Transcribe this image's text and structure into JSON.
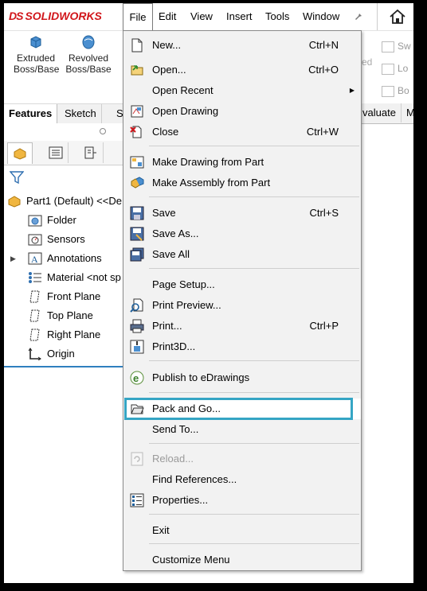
{
  "app": {
    "logo_prefix": "DS",
    "logo_text": "SOLIDWORKS"
  },
  "menubar": {
    "items": [
      "File",
      "Edit",
      "View",
      "Insert",
      "Tools",
      "Window"
    ],
    "pin_icon": "pin-icon",
    "home_icon": "home-icon"
  },
  "command_manager": {
    "extruded": {
      "line1": "Extruded",
      "line2": "Boss/Base",
      "icon": "extruded-boss-icon"
    },
    "revolved": {
      "line1": "Revolved",
      "line2": "Boss/Base",
      "icon": "revolved-boss-icon"
    },
    "right_fragments": [
      "Sw",
      "Lo",
      "Bo"
    ],
    "ed_fragment": "ed"
  },
  "tabs": {
    "features": "Features",
    "sketch": "Sketch",
    "s_fragment": "S",
    "evaluate_fragment": "valuate",
    "m_fragment": "M"
  },
  "feature_tree": {
    "part": "Part1 (Default) <<De",
    "items": [
      {
        "label": "Folder",
        "icon": "folder-icon"
      },
      {
        "label": "Sensors",
        "icon": "sensors-icon"
      },
      {
        "label": "Annotations",
        "icon": "annotations-icon"
      },
      {
        "label": "Material <not sp",
        "icon": "material-icon"
      },
      {
        "label": "Front Plane",
        "icon": "plane-icon"
      },
      {
        "label": "Top Plane",
        "icon": "plane-icon"
      },
      {
        "label": "Right Plane",
        "icon": "plane-icon"
      },
      {
        "label": "Origin",
        "icon": "origin-icon"
      }
    ]
  },
  "file_menu": {
    "new": {
      "label": "New...",
      "shortcut": "Ctrl+N"
    },
    "open": {
      "label": "Open...",
      "shortcut": "Ctrl+O"
    },
    "open_recent": {
      "label": "Open Recent"
    },
    "open_drawing": {
      "label": "Open Drawing"
    },
    "close": {
      "label": "Close",
      "shortcut": "Ctrl+W"
    },
    "make_drawing": {
      "label": "Make Drawing from Part"
    },
    "make_assembly": {
      "label": "Make Assembly from Part"
    },
    "save": {
      "label": "Save",
      "shortcut": "Ctrl+S"
    },
    "save_as": {
      "label": "Save As..."
    },
    "save_all": {
      "label": "Save All"
    },
    "page_setup": {
      "label": "Page Setup..."
    },
    "print_preview": {
      "label": "Print Preview..."
    },
    "print": {
      "label": "Print...",
      "shortcut": "Ctrl+P"
    },
    "print3d": {
      "label": "Print3D..."
    },
    "publish": {
      "label": "Publish to eDrawings"
    },
    "pack_and_go": {
      "label": "Pack and Go...",
      "highlighted": true,
      "highlight_color": "#35a5c4"
    },
    "send_to": {
      "label": "Send To..."
    },
    "reload": {
      "label": "Reload...",
      "disabled": true
    },
    "find_references": {
      "label": "Find References..."
    },
    "properties": {
      "label": "Properties..."
    },
    "exit": {
      "label": "Exit"
    },
    "customize": {
      "label": "Customize Menu"
    }
  },
  "colors": {
    "brand_red": "#d1161b",
    "highlight": "#35a5c4",
    "tree_accent": "#2f7fbf"
  }
}
